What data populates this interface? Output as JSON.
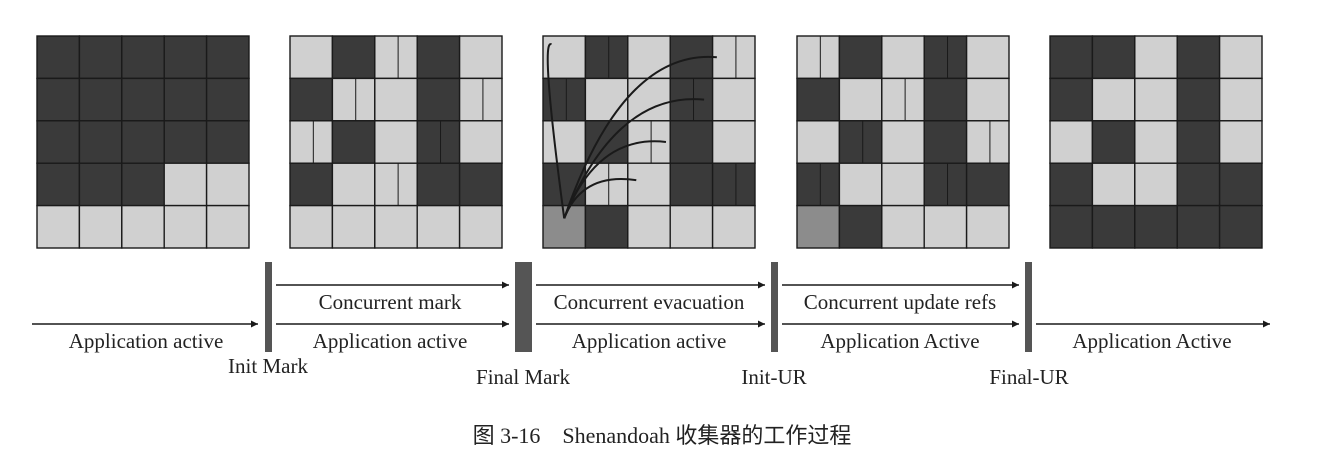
{
  "colors": {
    "dark": "#3a3a3a",
    "light": "#d0d0d0",
    "mid": "#8c8c8c",
    "grid_line": "#1a1a1a",
    "line": "#1a1a1a",
    "pause_bar": "#555555",
    "text": "#222222"
  },
  "heaps": [
    {
      "name": "heap-before-gc",
      "rows": [
        [
          "dark",
          "dark",
          "dark",
          "dark",
          "dark"
        ],
        [
          "dark",
          "dark",
          "dark",
          "dark",
          "dark"
        ],
        [
          "dark",
          "dark",
          "dark",
          "dark",
          "dark"
        ],
        [
          "dark",
          "dark",
          "dark",
          "light",
          "light"
        ],
        [
          "light",
          "light",
          "light",
          "light",
          "light"
        ]
      ]
    },
    {
      "name": "heap-concurrent-mark",
      "rows": [
        [
          "light",
          "dark",
          "light",
          "dark",
          "light"
        ],
        [
          "dark",
          "light",
          "light",
          "dark",
          "light"
        ],
        [
          "light",
          "dark",
          "light",
          "dark",
          "light"
        ],
        [
          "dark",
          "light",
          "light",
          "dark",
          "dark"
        ],
        [
          "light",
          "light",
          "light",
          "light",
          "light"
        ]
      ]
    },
    {
      "name": "heap-concurrent-evacuation",
      "rows": [
        [
          "light",
          "dark",
          "light",
          "dark",
          "light"
        ],
        [
          "dark",
          "light",
          "light",
          "dark",
          "light"
        ],
        [
          "light",
          "dark",
          "light",
          "dark",
          "light"
        ],
        [
          "dark",
          "light",
          "light",
          "dark",
          "dark"
        ],
        [
          "mid",
          "dark",
          "light",
          "light",
          "light"
        ]
      ]
    },
    {
      "name": "heap-concurrent-update-refs",
      "rows": [
        [
          "light",
          "dark",
          "light",
          "dark",
          "light"
        ],
        [
          "dark",
          "light",
          "light",
          "dark",
          "light"
        ],
        [
          "light",
          "dark",
          "light",
          "dark",
          "light"
        ],
        [
          "dark",
          "light",
          "light",
          "dark",
          "dark"
        ],
        [
          "mid",
          "dark",
          "light",
          "light",
          "light"
        ]
      ]
    },
    {
      "name": "heap-after-gc",
      "rows": [
        [
          "dark",
          "dark",
          "light",
          "dark",
          "light"
        ],
        [
          "dark",
          "light",
          "light",
          "dark",
          "light"
        ],
        [
          "light",
          "dark",
          "light",
          "dark",
          "light"
        ],
        [
          "dark",
          "light",
          "light",
          "dark",
          "dark"
        ],
        [
          "dark",
          "dark",
          "dark",
          "dark",
          "dark"
        ]
      ]
    }
  ],
  "phases": [
    {
      "name": "application-active-1",
      "labels": [
        "Application active"
      ]
    },
    {
      "name": "concurrent-mark-phase",
      "labels": [
        "Concurrent mark",
        "Application active"
      ]
    },
    {
      "name": "concurrent-evacuation-phase",
      "labels": [
        "Concurrent evacuation",
        "Application active"
      ]
    },
    {
      "name": "concurrent-update-refs-phase",
      "labels": [
        "Concurrent update refs",
        "Application Active"
      ]
    },
    {
      "name": "application-active-final",
      "labels": [
        "Application Active"
      ]
    }
  ],
  "pauses": [
    {
      "name": "init-mark-pause",
      "label": "Init Mark"
    },
    {
      "name": "final-mark-pause",
      "label": "Final Mark"
    },
    {
      "name": "init-ur-pause",
      "label": "Init-UR"
    },
    {
      "name": "final-ur-pause",
      "label": "Final-UR"
    }
  ],
  "caption": "图 3-16　Shenandoah 收集器的工作过程"
}
